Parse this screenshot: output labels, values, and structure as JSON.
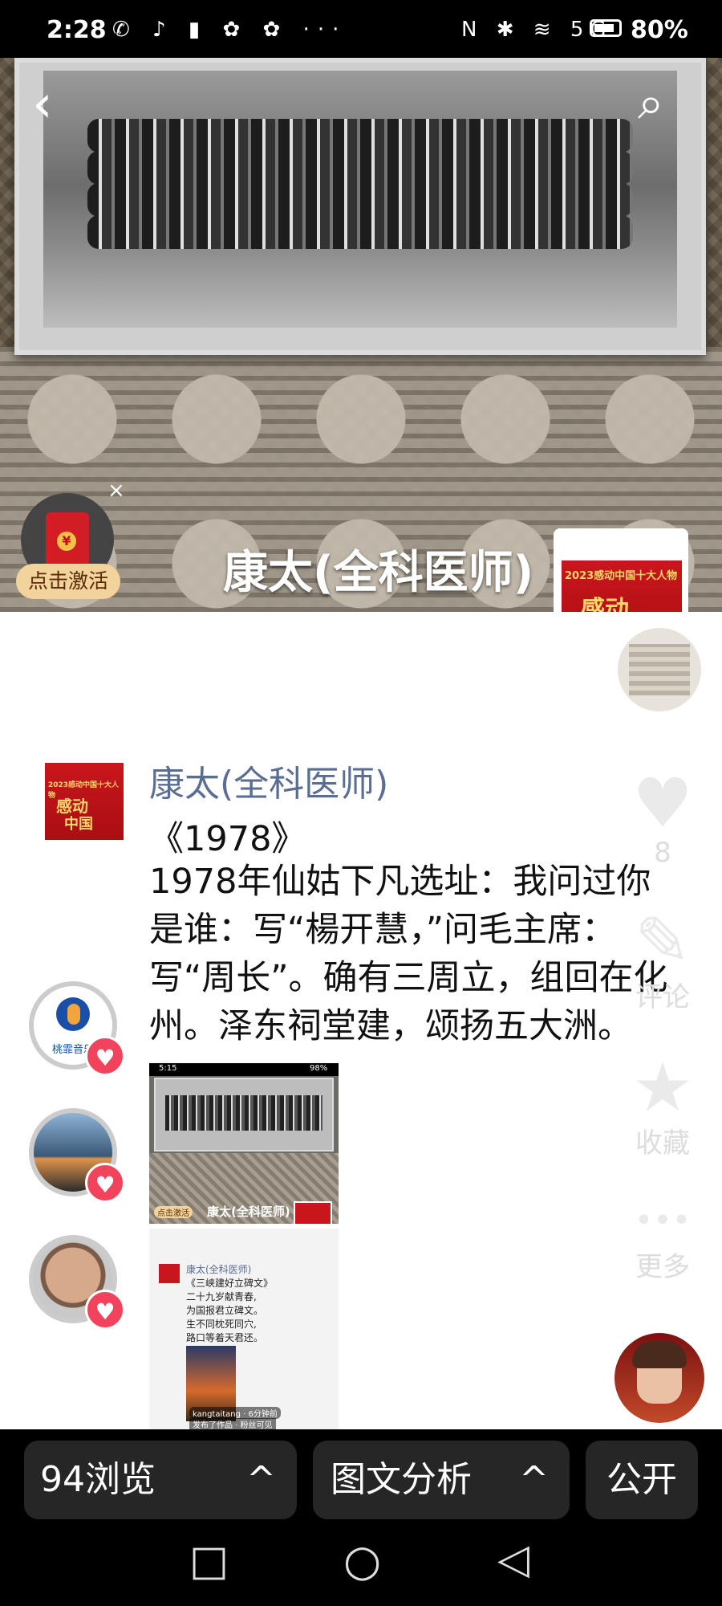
{
  "status_bar": {
    "time": "2:28",
    "left_icons": "✆ ♪ ▮ ✿ ✿ ···",
    "right_icons": "N ✱ ≋ 5G",
    "battery": "80%"
  },
  "top": {
    "back_icon": "‹",
    "search_icon": "⌕",
    "author_name": "康太(全科医师)",
    "red_packet_label": "点击激活",
    "red_packet_close": "×",
    "coin": "¥"
  },
  "poster": {
    "line1": "2023感动中国十大人物",
    "line2": "感动",
    "line3": "中国"
  },
  "post": {
    "author": "康太(全科医师)",
    "title": "《1978》",
    "body": "1978年仙姑下凡选址：我问过你是谁：写“楊开慧，”问毛主席：写“周长”。确有三周立，组回在化州。泽东祠堂建，颂扬五大洲。"
  },
  "actions": {
    "like_icon": "♥",
    "like_count": "8",
    "comment_icon": "✎",
    "comment_label": "评论",
    "collect_icon": "★",
    "collect_label": "收藏",
    "more_icon": "•••",
    "more_label": "更多"
  },
  "left_avatars": {
    "first_label": "桃霏音乐"
  },
  "shot1": {
    "time": "5:15",
    "battery": "98%",
    "name": "康太(全科医师)",
    "pill": "点击激活"
  },
  "shot2": {
    "author": "康太(全科医师)",
    "lines": [
      "《三峡建好立碑文》",
      "二十九岁献青春,",
      "为国报君立碑文。",
      "生不同枕死同穴,",
      "路口等着天君还。"
    ],
    "footer1": "kangtaitang · 6分钟前",
    "footer2": "发布了作品 · 粉丝可见"
  },
  "bottom_bar": {
    "views": "94浏览",
    "analysis": "图文分析",
    "public": "公开",
    "chevron": "^"
  },
  "nav": {
    "square": "□",
    "circle": "○",
    "back": "◁"
  }
}
